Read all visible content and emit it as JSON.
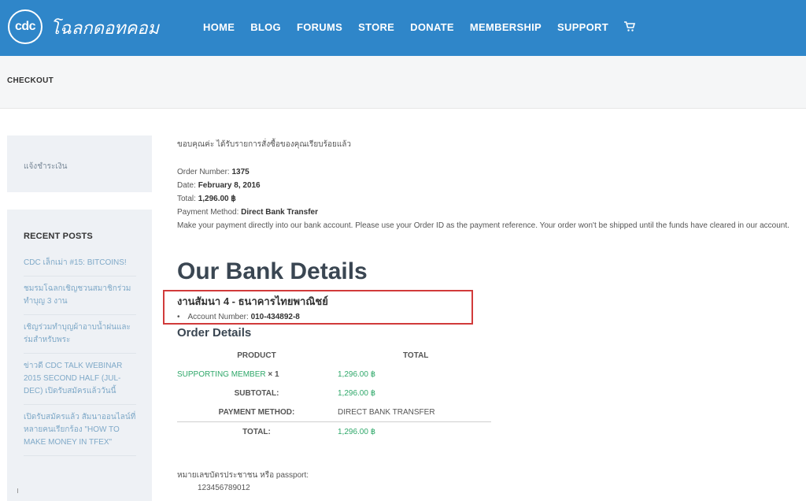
{
  "header": {
    "logo_abbr": "cdc",
    "logo_text": "โฉลกดอทคอม",
    "nav": [
      "HOME",
      "BLOG",
      "FORUMS",
      "STORE",
      "DONATE",
      "MEMBERSHIP",
      "SUPPORT"
    ],
    "cart_icon": "cart-icon"
  },
  "page_title": "CHECKOUT",
  "sidebar": {
    "payment_notice": "แจ้งชำระเงิน",
    "recent_posts_title": "RECENT POSTS",
    "posts": [
      "CDC เล็กเม่า #15: BITCOINS!",
      "ชมรมโฉลกเชิญชวนสมาชิกร่วมทำบุญ 3 งาน",
      "เชิญร่วมทำบุญผ้าอาบน้ำฝนและร่มสำหรับพระ",
      "ข่าวดี CDC TALK WEBINAR 2015 SECOND HALF (JUL-DEC) เปิดรับสมัครแล้ววันนี้",
      "เปิดรับสมัครแล้ว สัมนาออนไลน์ที่หลายคนเรียกร้อง \"HOW TO MAKE MONEY IN TFEX\""
    ]
  },
  "order": {
    "thanks": "ขอบคุณค่ะ ได้รับรายการสั่งซื้อของคุณเรียบร้อยแล้ว",
    "number_label": "Order Number:",
    "number": "1375",
    "date_label": "Date:",
    "date": "February 8, 2016",
    "total_label": "Total:",
    "total": "1,296.00 ฿",
    "method_label": "Payment Method:",
    "method": "Direct Bank Transfer",
    "instructions": "Make your payment directly into our bank account. Please use your Order ID as the payment reference. Your order won't be shipped until the funds have cleared in our account."
  },
  "bank": {
    "heading": "Our Bank Details",
    "name": "งานสัมนา 4 - ธนาคารไทยพาณิชย์",
    "account_label": "Account Number:",
    "account_number": "010-434892-8",
    "highlight_color": "#d13b3b"
  },
  "order_details": {
    "heading": "Order Details",
    "columns": [
      "PRODUCT",
      "TOTAL"
    ],
    "product_name": "SUPPORTING MEMBER",
    "product_qty": "× 1",
    "product_total": "1,296.00 ฿",
    "subtotal_label": "SUBTOTAL:",
    "subtotal": "1,296.00 ฿",
    "payment_method_label": "PAYMENT METHOD:",
    "payment_method": "DIRECT BANK TRANSFER",
    "total_label": "TOTAL:",
    "total": "1,296.00 ฿"
  },
  "id_card": {
    "label": "หมายเลขบัตรประชาชน หรือ passport:",
    "value": "123456789012"
  },
  "colors": {
    "header_bg": "#2f86c9",
    "accent_green": "#2fa86a",
    "sidebar_bg": "#eef1f5"
  }
}
